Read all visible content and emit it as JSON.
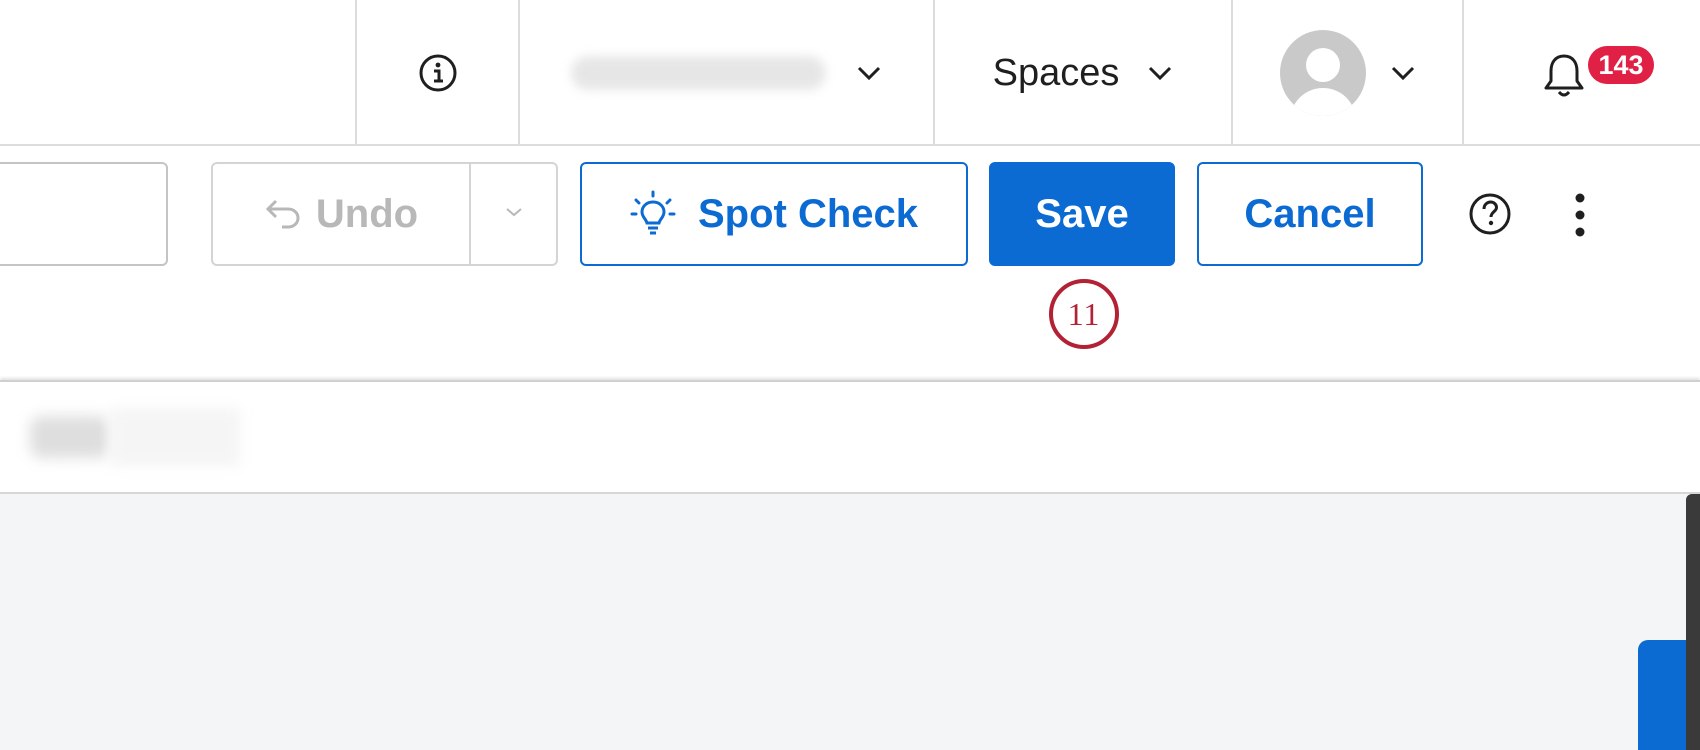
{
  "header": {
    "brand_label": "",
    "spaces_label": "Spaces",
    "notification_count": "143"
  },
  "toolbar": {
    "undo_label": "Undo",
    "spot_check_label": "Spot Check",
    "save_label": "Save",
    "cancel_label": "Cancel"
  },
  "annotation": {
    "step_number": "11"
  },
  "icons": {
    "info": "info-icon",
    "chevron": "chevron-down-icon",
    "avatar": "avatar",
    "bell": "bell-icon",
    "undo": "undo-arrow-icon",
    "bulb": "lightbulb-icon",
    "help": "help-icon",
    "kebab": "kebab-menu-icon"
  },
  "colors": {
    "accent": "#0b6bd2",
    "badge": "#e02045",
    "step_marker": "#b22234",
    "disabled_text": "#b8b8b8"
  }
}
